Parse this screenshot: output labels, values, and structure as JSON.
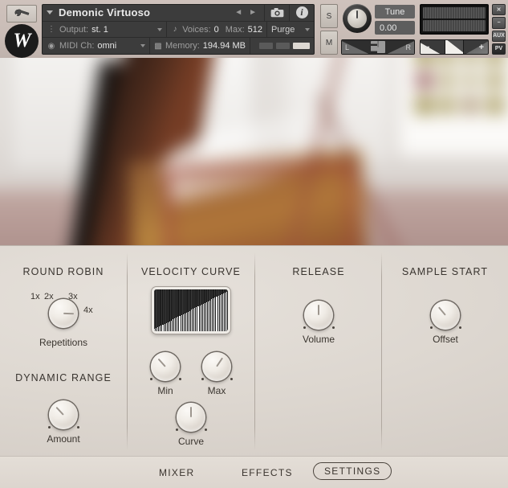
{
  "header": {
    "wrench_icon": "wrench-icon",
    "logo_letter": "W",
    "instrument_name": "Demonic Virtuoso",
    "prev_arrow": "◄",
    "next_arrow": "►",
    "camera_icon": "camera-icon",
    "info_icon": "info-icon",
    "output_label": "Output:",
    "output_value": "st. 1",
    "midi_label": "MIDI Ch:",
    "midi_value": "omni",
    "voices_label": "Voices:",
    "voices_value": "0",
    "max_label": "Max:",
    "max_value": "512",
    "memory_label": "Memory:",
    "memory_value": "194.94 MB",
    "purge_label": "Purge",
    "solo_label": "S",
    "mute_label": "M",
    "tune_label": "Tune",
    "tune_value": "0.00",
    "pan_left": "L",
    "pan_right": "R",
    "pan_center_icon": "pan-center-icon",
    "vol_minus": "−",
    "vol_plus": "+",
    "edge_close": "✕",
    "edge_minimize": "−",
    "edge_aux": "AUX",
    "edge_pv": "PV"
  },
  "panel": {
    "sections": [
      {
        "title": "ROUND ROBIN",
        "knob_label": "Repetitions",
        "marks": [
          "1x",
          "2x",
          "3x",
          "4x"
        ]
      },
      {
        "title": "DYNAMIC RANGE",
        "knob_label": "Amount"
      },
      {
        "title": "VELOCITY CURVE",
        "knobs": [
          {
            "label": "Min"
          },
          {
            "label": "Max"
          },
          {
            "label": "Curve"
          }
        ]
      },
      {
        "title": "RELEASE",
        "knob_label": "Volume"
      },
      {
        "title": "SAMPLE START",
        "knob_label": "Offset"
      }
    ]
  },
  "footer": {
    "tabs": [
      {
        "label": "MIXER",
        "active": false
      },
      {
        "label": "EFFECTS",
        "active": false
      },
      {
        "label": "SETTINGS",
        "active": true
      }
    ]
  },
  "colors": {
    "panel_bg": "#ddd7d0",
    "header_bg": "#c9bcb6",
    "rack_bg": "#3c3c3c",
    "text_dark": "#3a352f",
    "accent_red": "#a0463d"
  }
}
